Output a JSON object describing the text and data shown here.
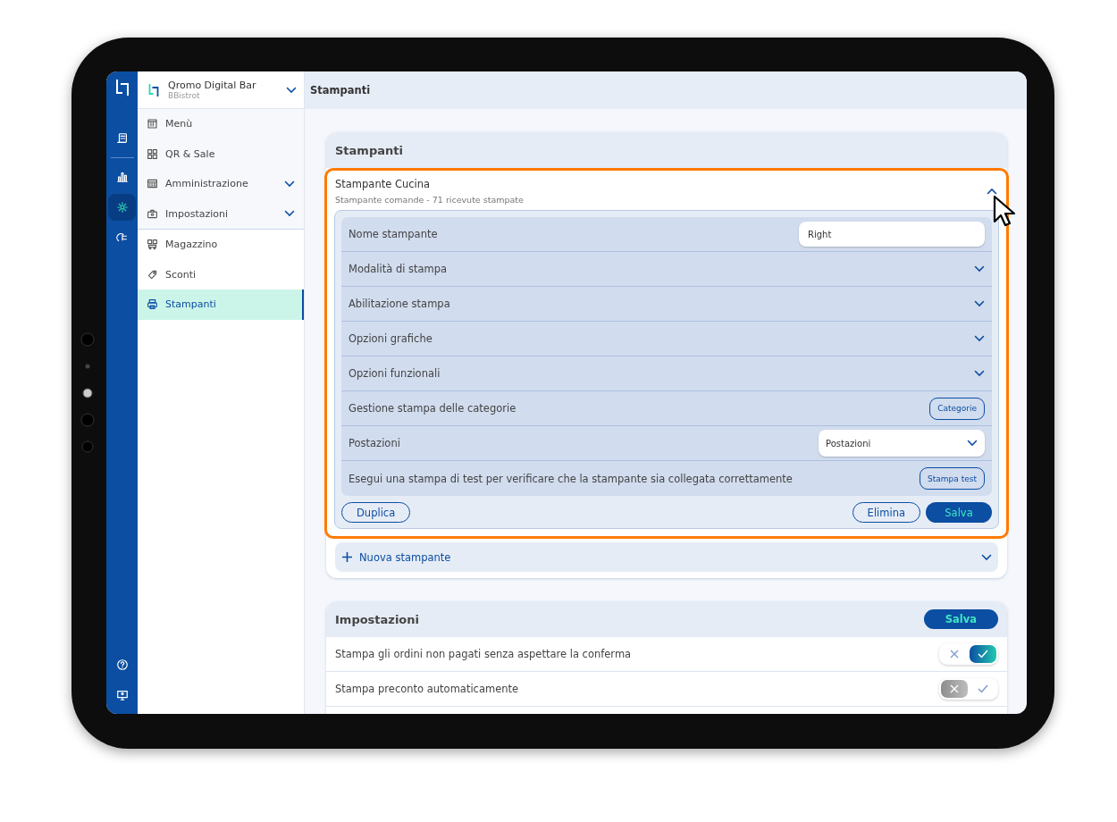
{
  "brand": {
    "name": "Qromo Digital Bar",
    "subtitle": "BBistrot"
  },
  "rail": {
    "top": [
      {
        "kind": "receipt",
        "selected": false
      },
      {
        "kind": "chart",
        "selected": false
      },
      {
        "kind": "gear",
        "selected": true
      },
      {
        "kind": "plug",
        "selected": false
      }
    ],
    "bottom": [
      {
        "kind": "help"
      },
      {
        "kind": "monitor"
      }
    ]
  },
  "sidebar": {
    "groups": [
      [
        {
          "label": "Menù",
          "kind": "menu",
          "expandable": false,
          "selected": false
        },
        {
          "label": "QR & Sale",
          "kind": "qr",
          "expandable": false,
          "selected": false
        },
        {
          "label": "Amministrazione",
          "kind": "calc",
          "expandable": true,
          "selected": false
        },
        {
          "label": "Impostazioni",
          "kind": "case",
          "expandable": true,
          "selected": false
        }
      ],
      [
        {
          "label": "Magazzino",
          "kind": "boxes",
          "expandable": false,
          "selected": false
        },
        {
          "label": "Sconti",
          "kind": "tag",
          "expandable": false,
          "selected": false
        },
        {
          "label": "Stampanti",
          "kind": "printer",
          "expandable": false,
          "selected": true
        }
      ]
    ]
  },
  "header": {
    "title": "Stampanti"
  },
  "printers_card": {
    "title": "Stampanti",
    "printers": [
      {
        "name": "Stampante Cucina",
        "subtitle": "Stampante comande - 71 ricevute stampate",
        "expanded": true,
        "highlighted": true,
        "settings": [
          {
            "kind": "input",
            "label": "Nome stampante",
            "value": "Right"
          },
          {
            "kind": "collapsible",
            "label": "Modalità di stampa"
          },
          {
            "kind": "collapsible",
            "label": "Abilitazione stampa"
          },
          {
            "kind": "collapsible",
            "label": "Opzioni grafiche"
          },
          {
            "kind": "collapsible",
            "label": "Opzioni funzionali"
          },
          {
            "kind": "button",
            "label": "Gestione stampa delle categorie",
            "button": "Categorie"
          },
          {
            "kind": "select",
            "label": "Postazioni",
            "value": "Postazioni"
          },
          {
            "kind": "button",
            "label": "Esegui una stampa di test per verificare che la stampante sia collegata correttamente",
            "button": "Stampa test"
          }
        ],
        "actions": [
          {
            "label": "Duplica",
            "kind": "outline"
          },
          {
            "label": "Elimina",
            "kind": "outline"
          },
          {
            "label": "Salva",
            "kind": "primary"
          }
        ]
      }
    ],
    "new_printer": "Nuova stampante"
  },
  "settings_card": {
    "title": "Impostazioni",
    "save": "Salva",
    "options": [
      {
        "label": "Stampa gli ordini non pagati senza aspettare la conferma",
        "on": true
      },
      {
        "label": "Stampa preconto automaticamente",
        "on": false
      }
    ]
  }
}
